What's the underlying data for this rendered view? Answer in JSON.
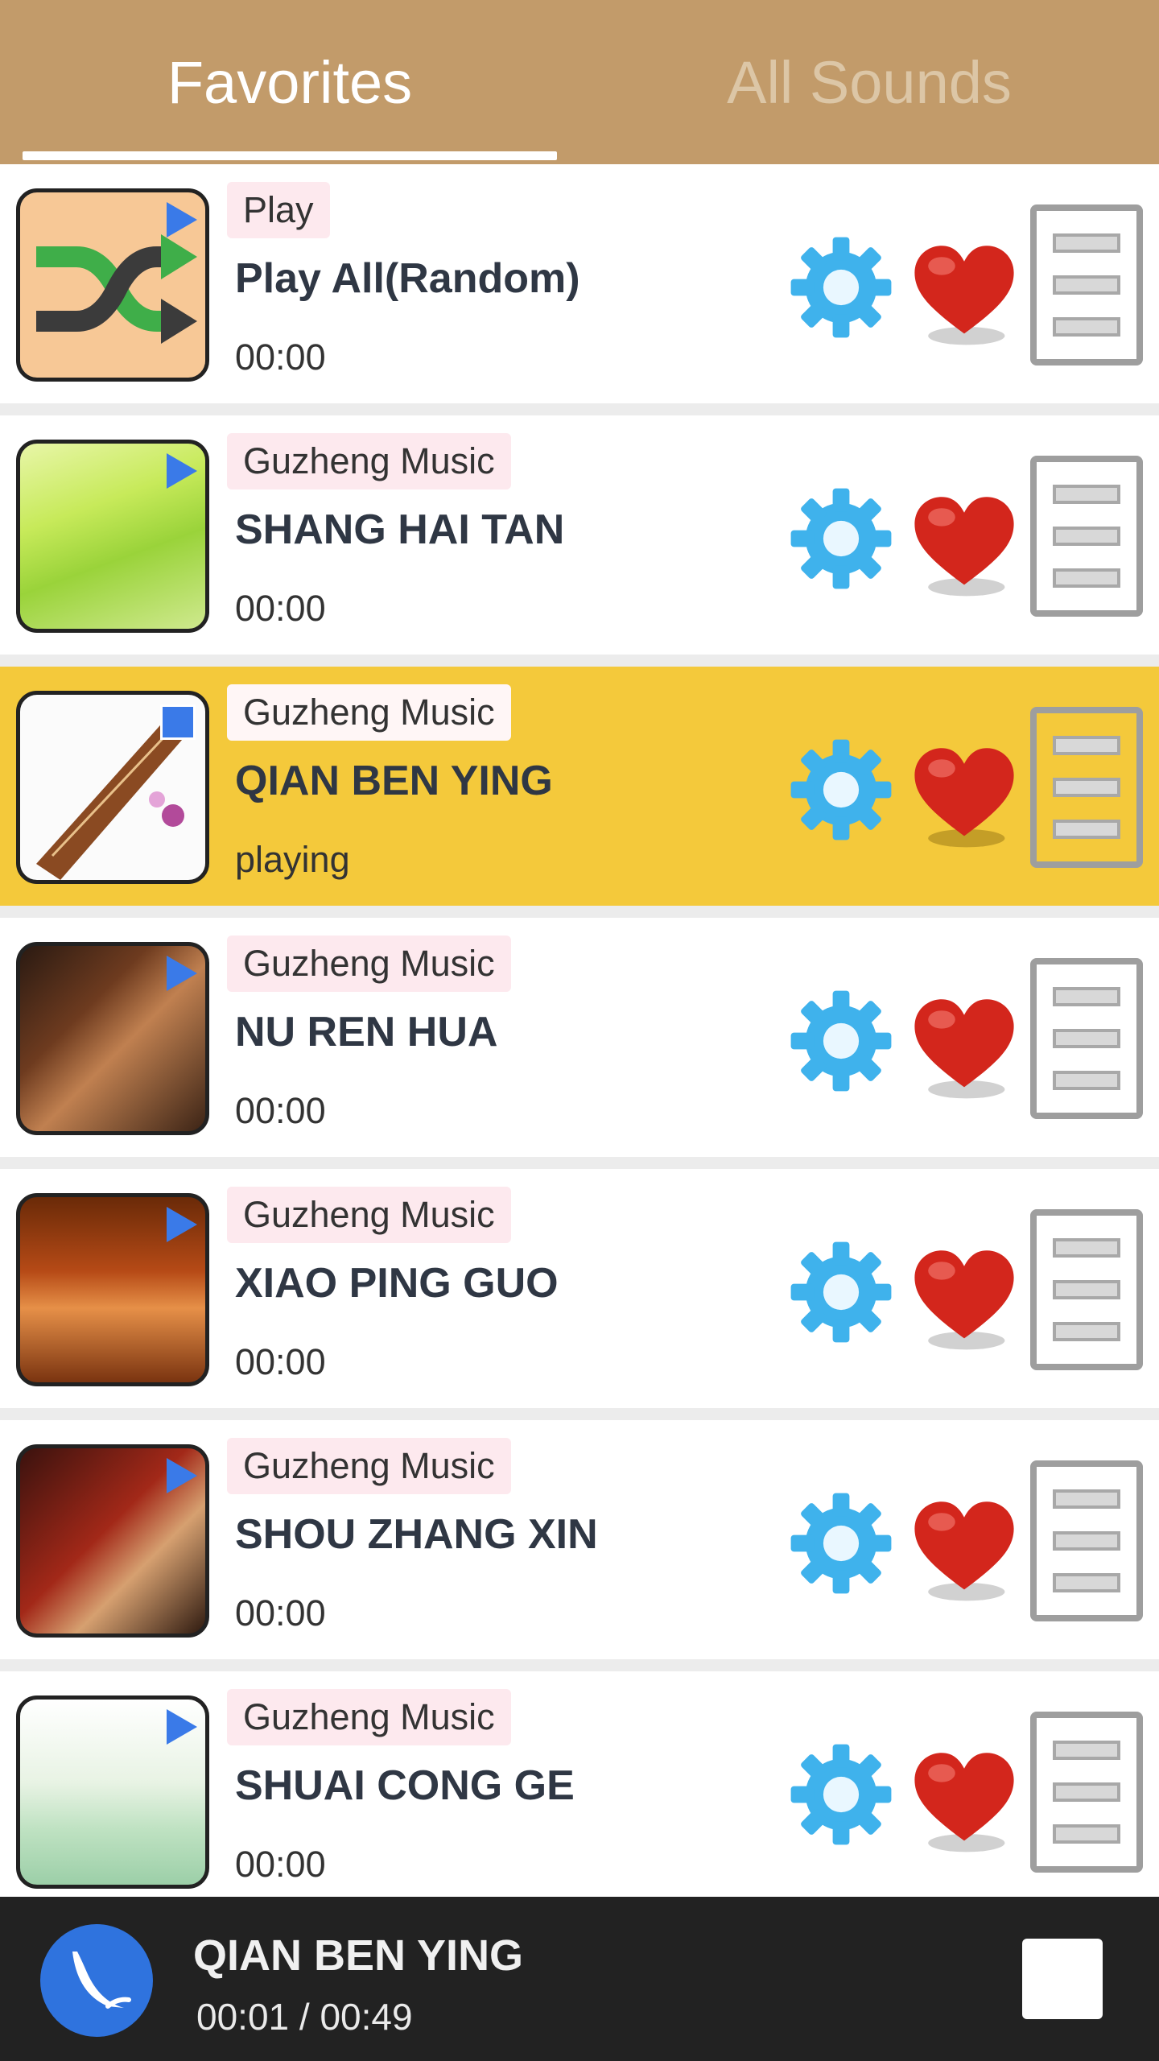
{
  "tabs": {
    "favorites": "Favorites",
    "all_sounds": "All Sounds",
    "selected": "Favorites"
  },
  "list": [
    {
      "tag": "Play",
      "title": "Play All(Random)",
      "time": "00:00",
      "thumb": "shuffle-icon",
      "state": "idle"
    },
    {
      "tag": "Guzheng Music",
      "title": "SHANG HAI TAN",
      "time": "00:00",
      "thumb": "guzheng-image",
      "state": "idle"
    },
    {
      "tag": "Guzheng Music",
      "title": "QIAN BEN YING",
      "time": "playing",
      "thumb": "guzheng-image",
      "state": "playing"
    },
    {
      "tag": "Guzheng Music",
      "title": "NU REN HUA",
      "time": "00:00",
      "thumb": "guzheng-image",
      "state": "idle"
    },
    {
      "tag": "Guzheng Music",
      "title": "XIAO PING GUO",
      "time": "00:00",
      "thumb": "guzheng-image",
      "state": "idle"
    },
    {
      "tag": "Guzheng Music",
      "title": "SHOU ZHANG XIN",
      "time": "00:00",
      "thumb": "guzheng-image",
      "state": "idle"
    },
    {
      "tag": "Guzheng Music",
      "title": "SHUAI CONG GE",
      "time": "00:00",
      "thumb": "guzheng-image",
      "state": "idle"
    }
  ],
  "row_icons": [
    "gear-icon",
    "heart-icon",
    "menu-icon"
  ],
  "player": {
    "title": "QIAN BEN YING",
    "time": "00:01 / 00:49",
    "progress": 0.02
  },
  "colors": {
    "header": "#c29b6a",
    "active_row": "#f4c93b",
    "player_bg": "#222222",
    "accent_blue": "#3a7ae8",
    "gear_blue": "#3fb2ec",
    "heart_red": "#d3261c"
  }
}
